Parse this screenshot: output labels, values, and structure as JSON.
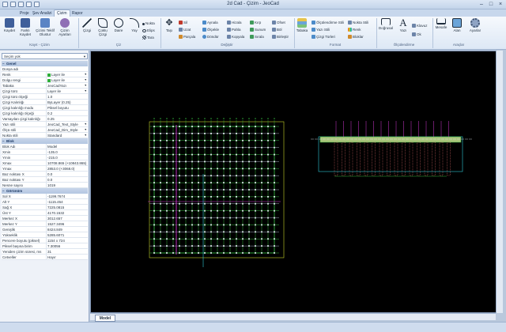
{
  "window": {
    "title": "2d Cad - Çizim - JeoCad"
  },
  "tabs": [
    "Proje",
    "Şev Analizi",
    "Çizim",
    "Rapor"
  ],
  "active_tab": "Çizim",
  "ribbon": {
    "groups": [
      "Kayıt - Çizim",
      "Çiz",
      "Değiştir",
      "Format",
      "Ölçülendirme",
      "Araçlar"
    ],
    "kayit": {
      "kaydet": "Kaydet",
      "farkli_kaydet": "Farklı Kaydet",
      "cizimi_teklif": "Çizimi Teklif Olustur",
      "cizim_ayarlari": "Çizim Ayarları"
    },
    "ciz": {
      "cizgi": "Çizgi",
      "coklu_cizgi": "Çoklu Çizgi",
      "daire": "Daire",
      "yay": "Yay",
      "nokta": "Nokta",
      "elips": "Elips",
      "tara": "Tara"
    },
    "degistir": {
      "tasi": "Taşı",
      "sil": "Sil",
      "uzat": "Uzat",
      "parcala": "Parçala",
      "aynala": "Aynala",
      "olcekle": "Ölçekle",
      "dondur": "Döndür",
      "hizala": "Hizala",
      "pahla": "Pahla",
      "kopyala": "Kopyala",
      "kirp": "Kırp",
      "sunum": "Sunum",
      "sirala": "Sırala",
      "ofset": "Ofset",
      "bol": "Böl",
      "birlestir": "Birleştir"
    },
    "format": {
      "tabaka": "Tabaka",
      "olculendirme_stili": "Ölçülendirme Stili",
      "yazi_stili": "Yazı Stili",
      "cizgi_turleri": "Çizgi Türleri",
      "nokta_stili": "Nokta Stili",
      "renk": "Renk",
      "bloklar": "Bloklar"
    },
    "olcu": {
      "dogrusal": "Doğrusal",
      "yazi": "Yazı",
      "klavuz": "Klavuz",
      "ok": "Ok"
    },
    "araclar": {
      "mesafe": "Mesafe",
      "alan": "Alan",
      "ayarlar": "Ayarlar"
    }
  },
  "panel": {
    "selection": "Seçim yok",
    "sections": [
      {
        "title": "Genel",
        "rows": [
          [
            "Dosya adı",
            ""
          ],
          [
            "Renk",
            "Layer ile"
          ],
          [
            "Dolgu rengi",
            "Layer ile"
          ],
          [
            "Tabaka",
            "JeoCadYazı"
          ],
          [
            "Çizgi türü",
            "Layer ile"
          ],
          [
            "Çizgi türü ölçeği",
            "1.0"
          ],
          [
            "Çizgi Kalınlığı",
            "ByLayer (0.25)"
          ],
          [
            "Çizgi kalınlığı modu",
            "Piksel boyutu"
          ],
          [
            "Çizgi kalınlığı ölçeği",
            "0.2"
          ],
          [
            "Varsayılan çizgi kalınlığı",
            "0.25"
          ],
          [
            "Yazı stili",
            "JeoCad_Text_Style"
          ],
          [
            "Ölçü stili",
            "JeoCad_Dim_Style"
          ],
          [
            "Nokta stili",
            "Standard"
          ]
        ]
      },
      {
        "title": "Blok",
        "rows": [
          [
            "Blok Adı",
            "Model"
          ],
          [
            "Xmin",
            "-135.0"
          ],
          [
            "Ymin",
            "-215.0"
          ],
          [
            "Xmax",
            "10708.865 (+10843.865)"
          ],
          [
            "Ymax",
            "2853.0 (+3068.0)"
          ],
          [
            "Baz noktası X",
            "0.0"
          ],
          [
            "Baz noktası Y",
            "0.0"
          ],
          [
            "Nesne sayısı",
            "1019"
          ]
        ]
      },
      {
        "title": "Görünüm",
        "rows": [
          [
            "Sol X",
            "-1199.7674"
          ],
          [
            "Alt Y",
            "-1115.454"
          ],
          [
            "Sağ X",
            "7225.0815"
          ],
          [
            "Üst Y",
            "4170.1532"
          ],
          [
            "Merkez X",
            "3012.657"
          ],
          [
            "Merkez Y",
            "1527.3496"
          ],
          [
            "Genişlik",
            "8424.849"
          ],
          [
            "Yükseklik",
            "5285.6071"
          ],
          [
            "Pencere boyutu (piksel)",
            "1154 x 724"
          ],
          [
            "Piksel başına birim",
            "7.30056"
          ],
          [
            "Yeniden çizim süresi, ms",
            "31"
          ],
          [
            "Cetveller",
            "Hayır"
          ]
        ]
      }
    ]
  },
  "canvas": {
    "model_tab": "Model"
  },
  "colors": {
    "accent": "#3a6fb5",
    "canvas": "#000000",
    "grid_line": "#2fae3a",
    "magenta": "#d238d2",
    "cyan": "#2ec8d8",
    "yellow_green": "#c6d42a"
  }
}
